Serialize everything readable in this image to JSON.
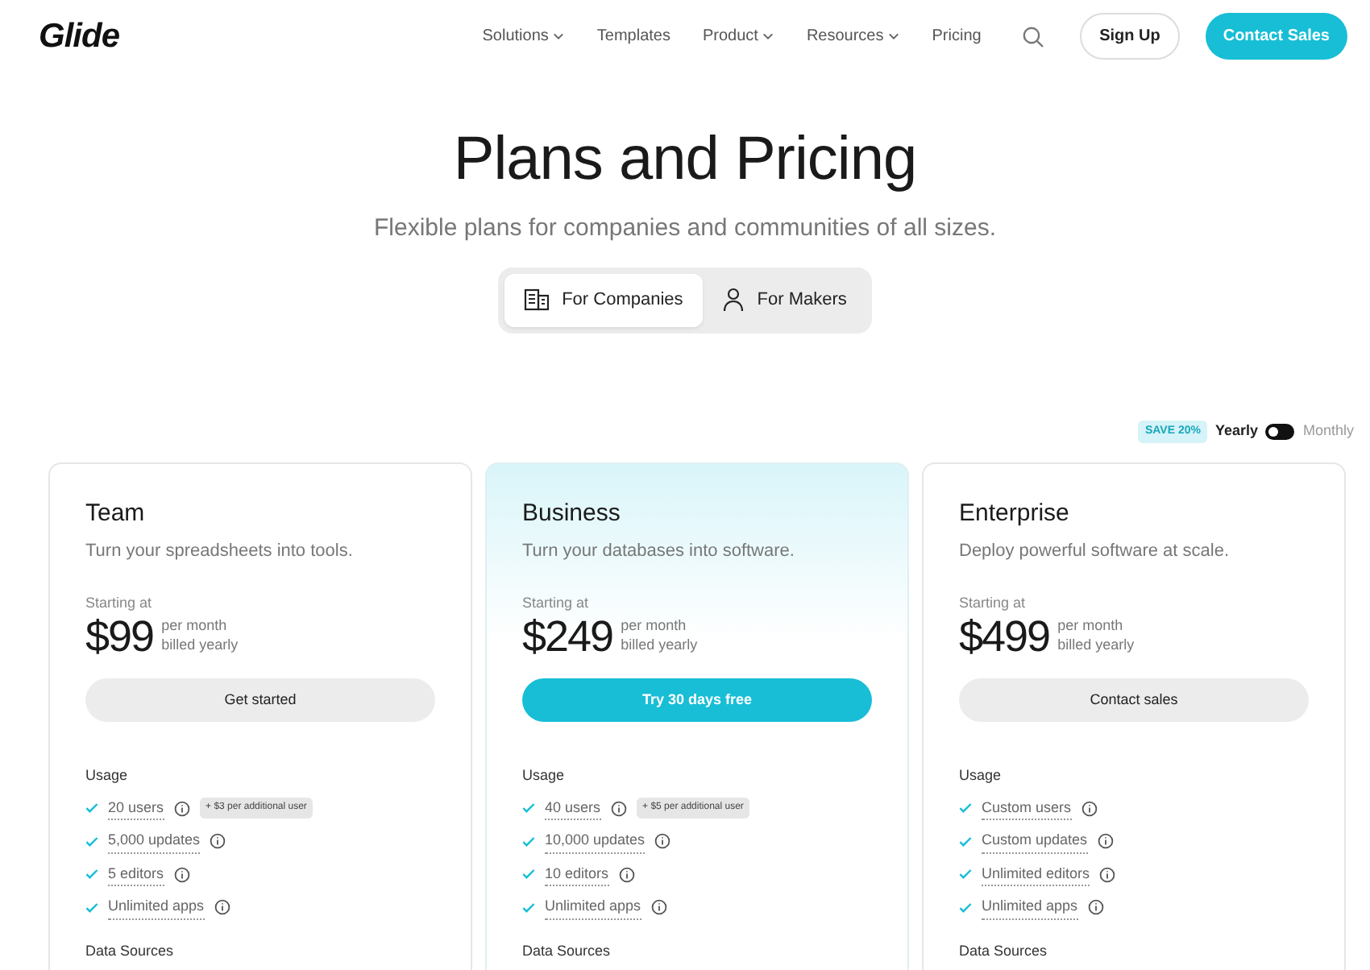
{
  "header": {
    "logo": "Glide",
    "nav": [
      {
        "label": "Solutions",
        "dropdown": true
      },
      {
        "label": "Templates",
        "dropdown": false
      },
      {
        "label": "Product",
        "dropdown": true
      },
      {
        "label": "Resources",
        "dropdown": true
      },
      {
        "label": "Pricing",
        "dropdown": false
      }
    ],
    "sign_up": "Sign Up",
    "contact_sales": "Contact Sales"
  },
  "hero": {
    "title": "Plans and Pricing",
    "subtitle": "Flexible plans for companies and communities of all sizes."
  },
  "audience_tabs": [
    {
      "label": "For Companies",
      "kind": "building",
      "selected": true
    },
    {
      "label": "For Makers",
      "kind": "person",
      "selected": false
    }
  ],
  "billing": {
    "badge": "SAVE 20%",
    "switch_on": false,
    "options": [
      {
        "label": "Yearly",
        "selected": true
      },
      {
        "label": "Monthly",
        "selected": false
      }
    ]
  },
  "plans": [
    {
      "name": "Team",
      "tagline": "Turn your spreadsheets into tools.",
      "starting": "Starting at",
      "price": "$99",
      "period": "per month",
      "billing": "billed yearly",
      "button": "Get started",
      "featured": false,
      "section": "Usage",
      "next_section": "Data Sources",
      "features": [
        {
          "text": "20 users",
          "extra": "+ $3 per additional user"
        },
        {
          "text": "5,000 updates"
        },
        {
          "text": "5 editors"
        },
        {
          "text": "Unlimited apps"
        }
      ]
    },
    {
      "name": "Business",
      "tagline": "Turn your databases into software.",
      "starting": "Starting at",
      "price": "$249",
      "period": "per month",
      "billing": "billed yearly",
      "button": "Try 30 days free",
      "featured": true,
      "section": "Usage",
      "next_section": "Data Sources",
      "features": [
        {
          "text": "40 users",
          "extra": "+ $5 per additional user"
        },
        {
          "text": "10,000 updates"
        },
        {
          "text": "10 editors"
        },
        {
          "text": "Unlimited apps"
        }
      ]
    },
    {
      "name": "Enterprise",
      "tagline": "Deploy powerful software at scale.",
      "starting": "Starting at",
      "price": "$499",
      "period": "per month",
      "billing": "billed yearly",
      "button": "Contact sales",
      "featured": false,
      "section": "Usage",
      "next_section": "Data Sources",
      "features": [
        {
          "text": "Custom users"
        },
        {
          "text": "Custom updates"
        },
        {
          "text": "Unlimited editors"
        },
        {
          "text": "Unlimited apps"
        }
      ]
    }
  ]
}
